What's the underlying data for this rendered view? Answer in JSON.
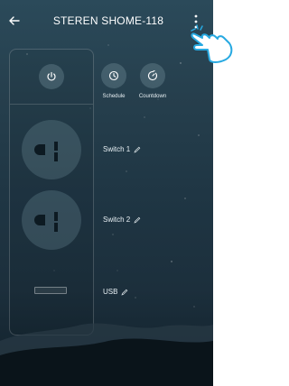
{
  "header": {
    "title": "STEREN SHOME-118"
  },
  "controls": {
    "power_icon": "power-icon",
    "schedule_label": "Schedule",
    "countdown_label": "Countdown"
  },
  "outlets": [
    {
      "label": "Switch 1"
    },
    {
      "label": "Switch 2"
    },
    {
      "label": "USB"
    }
  ],
  "colors": {
    "background_top": "#2b4a5a",
    "background_bottom": "#10202a",
    "button_fill": "#4f6b77",
    "text": "#ffffff"
  }
}
